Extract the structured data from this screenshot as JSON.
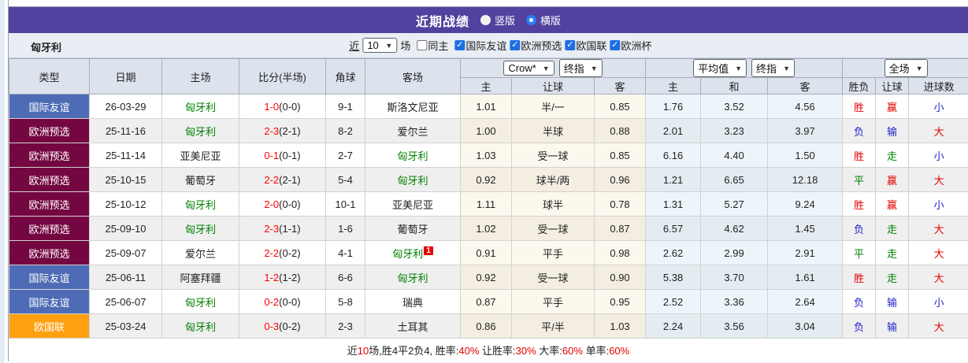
{
  "colors": {
    "accent_purple": "#52419e",
    "type_blue": "#4e6cb5",
    "type_maroon": "#740742",
    "type_orange": "#ffa011",
    "win_red": "#e60000",
    "lose_blue": "#2323cc",
    "draw_green": "#008000",
    "team_green": "#008000",
    "score_red": "#ff0000"
  },
  "header": {
    "title": "近期战绩",
    "radio_vertical": "竖版",
    "radio_horizontal": "横版",
    "selected_layout": "横版"
  },
  "filter": {
    "team": "匈牙利",
    "near_label": "近",
    "matches_select": "10",
    "matches_label": "场",
    "same_home": {
      "label": "同主",
      "checked": false
    },
    "leagues": [
      {
        "label": "国际友谊",
        "checked": true
      },
      {
        "label": "欧洲预选",
        "checked": true
      },
      {
        "label": "欧国联",
        "checked": true
      },
      {
        "label": "欧洲杯",
        "checked": true
      }
    ]
  },
  "table": {
    "columns": [
      "类型",
      "日期",
      "主场",
      "比分(半场)",
      "角球",
      "客场"
    ],
    "selects": {
      "book": "Crow*",
      "book_time": "终指",
      "avg": "平均值",
      "avg_time": "终指",
      "scope": "全场"
    },
    "handicap_cols": [
      "主",
      "让球",
      "客"
    ],
    "avg_cols": [
      "主",
      "和",
      "客"
    ],
    "outcome_cols": [
      "胜负",
      "让球",
      "进球数"
    ],
    "rows": [
      {
        "type": "国际友谊",
        "type_color": "blue",
        "date": "26-03-29",
        "home": "匈牙利",
        "home_team": true,
        "score": "1-0",
        "half": "(0-0)",
        "corner": "9-1",
        "away": "斯洛文尼亚",
        "away_team": false,
        "red": "",
        "h1": "1.01",
        "h2": "半/一",
        "h3": "0.85",
        "a1": "1.76",
        "a2": "3.52",
        "a3": "4.56",
        "res": {
          "t": "胜",
          "c": "r"
        },
        "hc": {
          "t": "赢",
          "c": "r"
        },
        "gl": {
          "t": "小",
          "c": "b"
        }
      },
      {
        "type": "欧洲预选",
        "type_color": "maroon",
        "date": "25-11-16",
        "home": "匈牙利",
        "home_team": true,
        "score": "2-3",
        "half": "(2-1)",
        "corner": "8-2",
        "away": "爱尔兰",
        "away_team": false,
        "red": "",
        "h1": "1.00",
        "h2": "半球",
        "h3": "0.88",
        "a1": "2.01",
        "a2": "3.23",
        "a3": "3.97",
        "res": {
          "t": "负",
          "c": "b"
        },
        "hc": {
          "t": "输",
          "c": "b"
        },
        "gl": {
          "t": "大",
          "c": "r"
        }
      },
      {
        "type": "欧洲预选",
        "type_color": "maroon",
        "date": "25-11-14",
        "home": "亚美尼亚",
        "home_team": false,
        "score": "0-1",
        "half": "(0-1)",
        "corner": "2-7",
        "away": "匈牙利",
        "away_team": true,
        "red": "",
        "h1": "1.03",
        "h2": "受一球",
        "h3": "0.85",
        "a1": "6.16",
        "a2": "4.40",
        "a3": "1.50",
        "res": {
          "t": "胜",
          "c": "r"
        },
        "hc": {
          "t": "走",
          "c": "g"
        },
        "gl": {
          "t": "小",
          "c": "b"
        }
      },
      {
        "type": "欧洲预选",
        "type_color": "maroon",
        "date": "25-10-15",
        "home": "葡萄牙",
        "home_team": false,
        "score": "2-2",
        "half": "(2-1)",
        "corner": "5-4",
        "away": "匈牙利",
        "away_team": true,
        "red": "",
        "h1": "0.92",
        "h2": "球半/两",
        "h3": "0.96",
        "a1": "1.21",
        "a2": "6.65",
        "a3": "12.18",
        "res": {
          "t": "平",
          "c": "g"
        },
        "hc": {
          "t": "赢",
          "c": "r"
        },
        "gl": {
          "t": "大",
          "c": "r"
        }
      },
      {
        "type": "欧洲预选",
        "type_color": "maroon",
        "date": "25-10-12",
        "home": "匈牙利",
        "home_team": true,
        "score": "2-0",
        "half": "(0-0)",
        "corner": "10-1",
        "away": "亚美尼亚",
        "away_team": false,
        "red": "",
        "h1": "1.11",
        "h2": "球半",
        "h3": "0.78",
        "a1": "1.31",
        "a2": "5.27",
        "a3": "9.24",
        "res": {
          "t": "胜",
          "c": "r"
        },
        "hc": {
          "t": "赢",
          "c": "r"
        },
        "gl": {
          "t": "小",
          "c": "b"
        }
      },
      {
        "type": "欧洲预选",
        "type_color": "maroon",
        "date": "25-09-10",
        "home": "匈牙利",
        "home_team": true,
        "score": "2-3",
        "half": "(1-1)",
        "corner": "1-6",
        "away": "葡萄牙",
        "away_team": false,
        "red": "",
        "h1": "1.02",
        "h2": "受一球",
        "h3": "0.87",
        "a1": "6.57",
        "a2": "4.62",
        "a3": "1.45",
        "res": {
          "t": "负",
          "c": "b"
        },
        "hc": {
          "t": "走",
          "c": "g"
        },
        "gl": {
          "t": "大",
          "c": "r"
        }
      },
      {
        "type": "欧洲预选",
        "type_color": "maroon",
        "date": "25-09-07",
        "home": "爱尔兰",
        "home_team": false,
        "score": "2-2",
        "half": "(0-2)",
        "corner": "4-1",
        "away": "匈牙利",
        "away_team": true,
        "red": "1",
        "h1": "0.91",
        "h2": "平手",
        "h3": "0.98",
        "a1": "2.62",
        "a2": "2.99",
        "a3": "2.91",
        "res": {
          "t": "平",
          "c": "g"
        },
        "hc": {
          "t": "走",
          "c": "g"
        },
        "gl": {
          "t": "大",
          "c": "r"
        }
      },
      {
        "type": "国际友谊",
        "type_color": "blue",
        "date": "25-06-11",
        "home": "阿塞拜疆",
        "home_team": false,
        "score": "1-2",
        "half": "(1-2)",
        "corner": "6-6",
        "away": "匈牙利",
        "away_team": true,
        "red": "",
        "h1": "0.92",
        "h2": "受一球",
        "h3": "0.90",
        "a1": "5.38",
        "a2": "3.70",
        "a3": "1.61",
        "res": {
          "t": "胜",
          "c": "r"
        },
        "hc": {
          "t": "走",
          "c": "g"
        },
        "gl": {
          "t": "大",
          "c": "r"
        }
      },
      {
        "type": "国际友谊",
        "type_color": "blue",
        "date": "25-06-07",
        "home": "匈牙利",
        "home_team": true,
        "score": "0-2",
        "half": "(0-0)",
        "corner": "5-8",
        "away": "瑞典",
        "away_team": false,
        "red": "",
        "h1": "0.87",
        "h2": "平手",
        "h3": "0.95",
        "a1": "2.52",
        "a2": "3.36",
        "a3": "2.64",
        "res": {
          "t": "负",
          "c": "b"
        },
        "hc": {
          "t": "输",
          "c": "b"
        },
        "gl": {
          "t": "小",
          "c": "b"
        }
      },
      {
        "type": "欧国联",
        "type_color": "orange",
        "date": "25-03-24",
        "home": "匈牙利",
        "home_team": true,
        "score": "0-3",
        "half": "(0-2)",
        "corner": "2-3",
        "away": "土耳其",
        "away_team": false,
        "red": "",
        "h1": "0.86",
        "h2": "平/半",
        "h3": "1.03",
        "a1": "2.24",
        "a2": "3.56",
        "a3": "3.04",
        "res": {
          "t": "负",
          "c": "b"
        },
        "hc": {
          "t": "输",
          "c": "b"
        },
        "gl": {
          "t": "大",
          "c": "r"
        }
      }
    ]
  },
  "footer": {
    "parts": [
      {
        "text": "近",
        "c": "k"
      },
      {
        "text": "10",
        "c": "r"
      },
      {
        "text": "场,胜4平2负4, 胜率:",
        "c": "k"
      },
      {
        "text": "40%",
        "c": "r"
      },
      {
        "text": " 让胜率:",
        "c": "k"
      },
      {
        "text": "30%",
        "c": "r"
      },
      {
        "text": " 大率:",
        "c": "k"
      },
      {
        "text": "60%",
        "c": "r"
      },
      {
        "text": " 单率:",
        "c": "k"
      },
      {
        "text": "60%",
        "c": "r"
      }
    ]
  }
}
